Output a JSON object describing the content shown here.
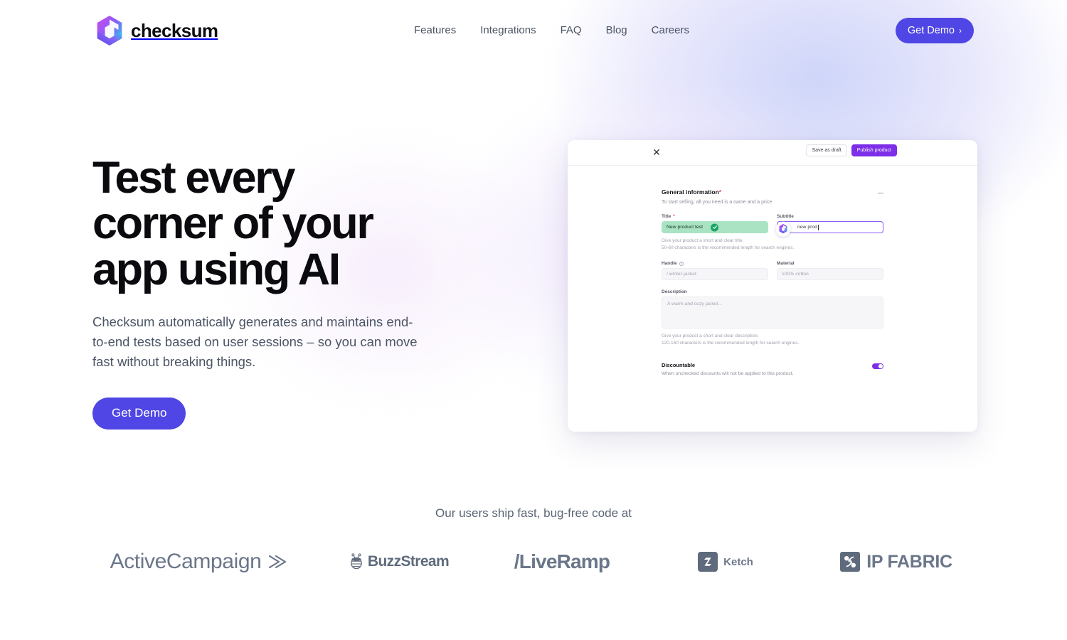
{
  "brand": {
    "name": "checksum",
    "logo_icon": "checksum-hexagon-logo",
    "accent_indigo": "#4f46e5",
    "accent_purple": "#7c2ee8",
    "logo_gradient_from": "#c026d3",
    "logo_gradient_to": "#22d3ee"
  },
  "header": {
    "nav": [
      {
        "label": "Features"
      },
      {
        "label": "Integrations"
      },
      {
        "label": "FAQ"
      },
      {
        "label": "Blog"
      },
      {
        "label": "Careers"
      }
    ],
    "cta": {
      "label": "Get Demo",
      "chevron": "›"
    }
  },
  "hero": {
    "title": "Test every corner of your app using AI",
    "subtitle": "Checksum automatically generates and maintains end-to-end tests based on user sessions – so you can move fast without breaking things.",
    "cta_label": "Get Demo"
  },
  "mock": {
    "close_icon": "close-icon",
    "save_draft_label": "Save as draft",
    "publish_label": "Publish product",
    "section": {
      "title": "General information",
      "required_marker": "*",
      "description": "To start selling, all you need is a name and a price.",
      "collapse_icon": "minus-icon"
    },
    "title_field": {
      "label": "Title",
      "required_marker": "*",
      "value": "New product test",
      "status_icon": "check-circle-icon"
    },
    "subtitle_field": {
      "label": "Subtitle",
      "value": "new prod",
      "cursor_icon": "checksum-cursor-icon"
    },
    "title_helper_line1": "Give your product a short and clear title.",
    "title_helper_line2": "50-60 characters is the recommended length for search engines.",
    "handle_field": {
      "label": "Handle",
      "info_icon": "info-icon",
      "placeholder": "/ winter-jacket"
    },
    "material_field": {
      "label": "Material",
      "placeholder": "100% cotton"
    },
    "description_field": {
      "label": "Description",
      "placeholder": "A warm and cozy jacket..."
    },
    "desc_helper_line1": "Give your product a short and clear description.",
    "desc_helper_line2": "120-160 characters is the recommended length for search engines.",
    "discountable": {
      "label": "Discountable",
      "description": "When unchecked discounts will not be applied to this product.",
      "state": "on"
    }
  },
  "social_proof": {
    "caption": "Our users ship fast, bug-free code at",
    "logos": [
      {
        "name": "ActiveCampaign",
        "icon": "activecampaign-chevron-icon"
      },
      {
        "name": "BuzzStream",
        "icon": "buzzstream-bee-icon"
      },
      {
        "name": "/LiveRamp",
        "icon": "liveramp-wordmark"
      },
      {
        "name": "Ketch",
        "icon": "ketch-mark-icon"
      },
      {
        "name": "IP FABRIC",
        "icon": "ipfabric-mark-icon"
      }
    ]
  }
}
